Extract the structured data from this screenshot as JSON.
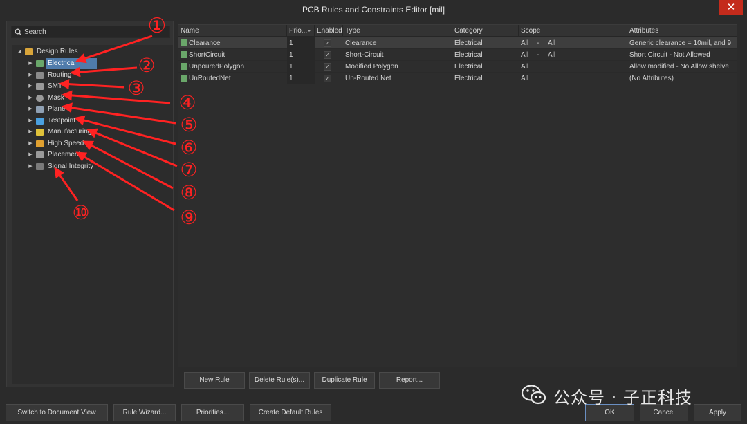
{
  "window": {
    "title": "PCB Rules and Constraints Editor [mil]",
    "close_glyph": "✕"
  },
  "search": {
    "placeholder": "Search"
  },
  "tree": {
    "root": {
      "label": "Design Rules",
      "icon": "folder-icon",
      "color": "#d9a53a"
    },
    "items": [
      {
        "label": "Electrical",
        "icon": "electrical-icon",
        "color": "#6aa76a"
      },
      {
        "label": "Routing",
        "icon": "routing-icon",
        "color": "#8a8a8a"
      },
      {
        "label": "SMT",
        "icon": "smt-icon",
        "color": "#9a9a9a"
      },
      {
        "label": "Mask",
        "icon": "mask-icon",
        "color": "#9a9a9a"
      },
      {
        "label": "Plane",
        "icon": "plane-icon",
        "color": "#8fa0b3"
      },
      {
        "label": "Testpoint",
        "icon": "testpoint-icon",
        "color": "#4aa0e0"
      },
      {
        "label": "Manufacturing",
        "icon": "manufacturing-icon",
        "color": "#e0c23a"
      },
      {
        "label": "High Speed",
        "icon": "high-speed-icon",
        "color": "#e0a030"
      },
      {
        "label": "Placement",
        "icon": "placement-icon",
        "color": "#9a9a9a"
      },
      {
        "label": "Signal Integrity",
        "icon": "signal-integrity-icon",
        "color": "#7a7a7a"
      }
    ]
  },
  "grid": {
    "columns": [
      "Name",
      "Prio...",
      "Enabled",
      "Type",
      "Category",
      "Scope",
      "Attributes"
    ],
    "check_glyph": "✓",
    "rows": [
      {
        "name": "Clearance",
        "priority": "1",
        "type": "Clearance",
        "category": "Electrical",
        "scope1": "All",
        "scope_dash": "-",
        "scope2": "All",
        "attributes": "Generic clearance = 10mil, and 9"
      },
      {
        "name": "ShortCircuit",
        "priority": "1",
        "type": "Short-Circuit",
        "category": "Electrical",
        "scope1": "All",
        "scope_dash": "-",
        "scope2": "All",
        "attributes": "Short Circuit - Not Allowed"
      },
      {
        "name": "UnpouredPolygon",
        "priority": "1",
        "type": "Modified Polygon",
        "category": "Electrical",
        "scope1": "All",
        "scope_dash": "",
        "scope2": "",
        "attributes": "Allow modified - No  Allow shelve"
      },
      {
        "name": "UnRoutedNet",
        "priority": "1",
        "type": "Un-Routed Net",
        "category": "Electrical",
        "scope1": "All",
        "scope_dash": "",
        "scope2": "",
        "attributes": "(No Attributes)"
      }
    ]
  },
  "grid_buttons": {
    "new_rule": "New Rule",
    "delete_rule": "Delete Rule(s)...",
    "duplicate_rule": "Duplicate Rule",
    "report": "Report..."
  },
  "bottom_buttons": {
    "switch_view": "Switch to Document View",
    "rule_wizard": "Rule Wizard...",
    "priorities": "Priorities...",
    "create_default": "Create Default Rules",
    "ok": "OK",
    "cancel": "Cancel",
    "apply": "Apply"
  },
  "watermark": {
    "text": "公众号 · 子正科技"
  },
  "annotations": {
    "color": "#ff2222",
    "labels": [
      "①",
      "②",
      "③",
      "④",
      "⑤",
      "⑥",
      "⑦",
      "⑧",
      "⑨",
      "⑩"
    ]
  }
}
